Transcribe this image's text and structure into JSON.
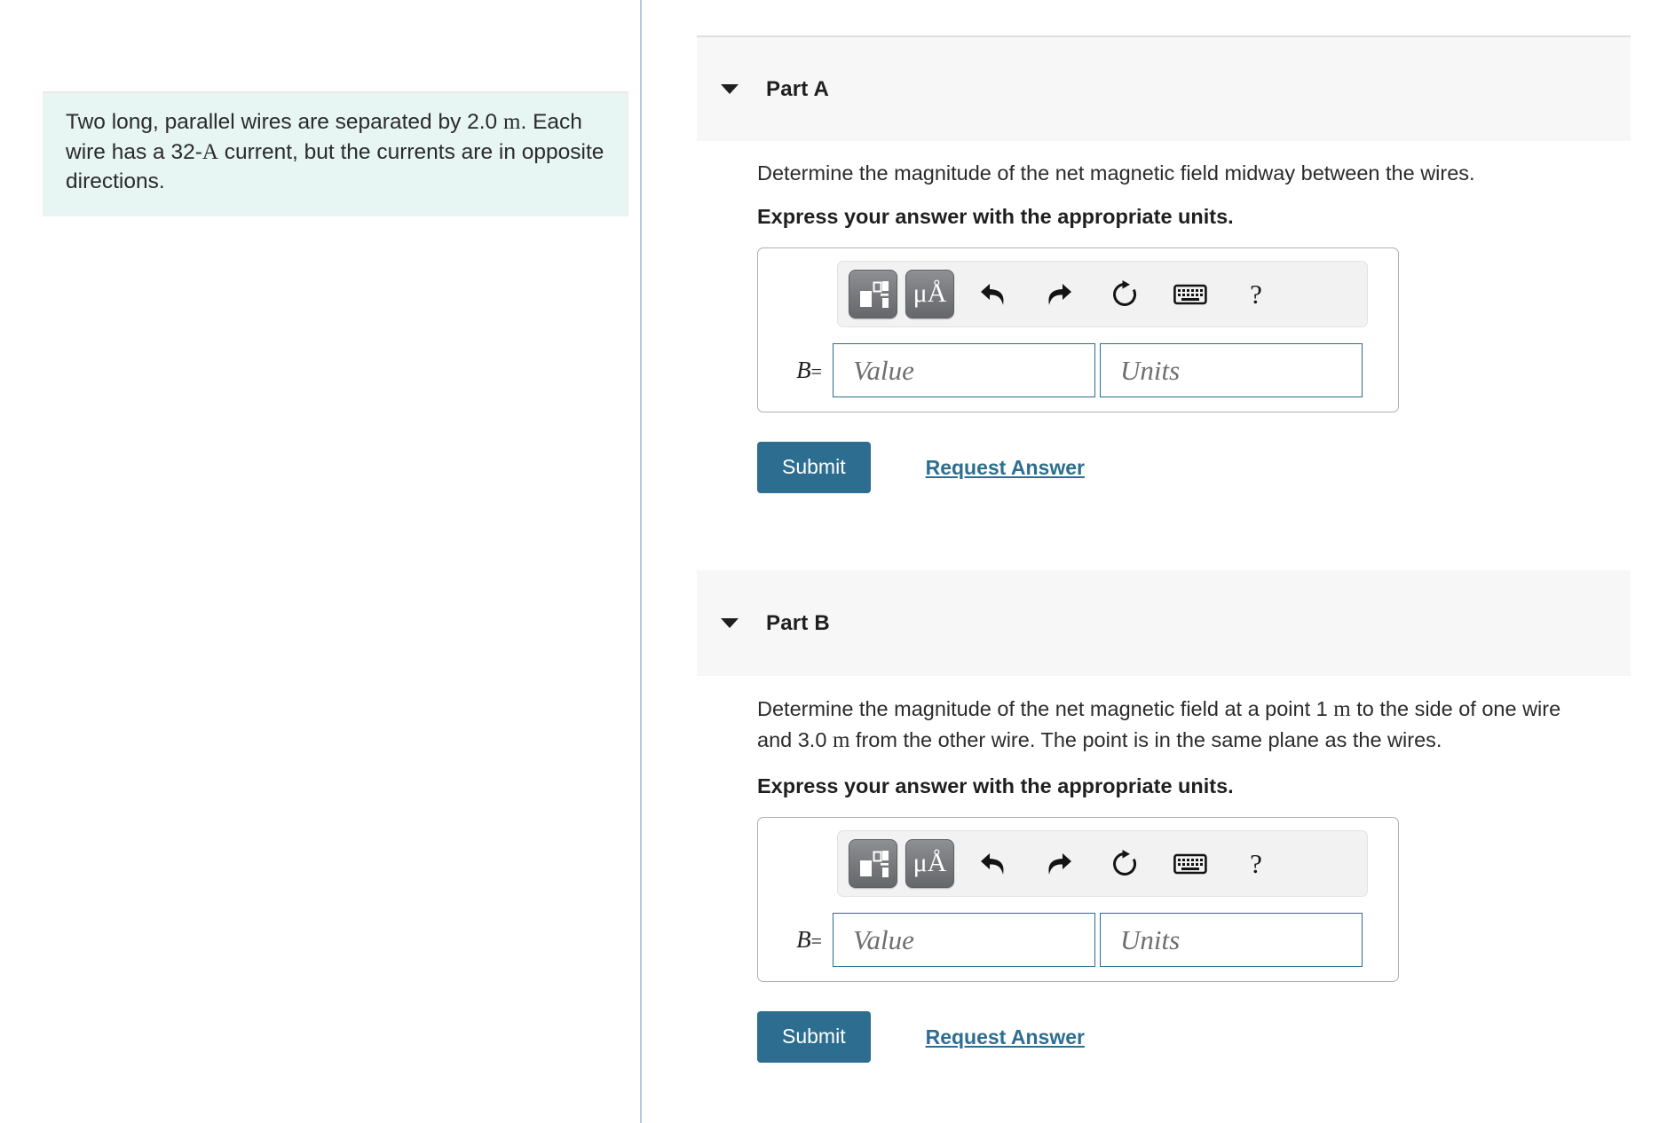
{
  "problem": {
    "text_line1": "Two long, parallel wires are separated by 2.0 ",
    "unit1": "m",
    "text_line1b": ". Each wire has a 32-",
    "unit2": "A",
    "text_line2": " current, but the currents are in opposite directions."
  },
  "parts": [
    {
      "title": "Part A",
      "caret": "chevron-down-icon",
      "question": "Determine the magnitude of the net magnetic field midway between the wires.",
      "instruction": "Express your answer with the appropriate units.",
      "answer": {
        "label": "B",
        "equals": "=",
        "value_placeholder": "Value",
        "units_placeholder": "Units",
        "value_text": "",
        "units_text": ""
      },
      "toolbar": [
        {
          "name": "math-template-icon",
          "title": "Templates"
        },
        {
          "name": "units-mu-angstrom-icon",
          "label": "μÅ",
          "title": "Units"
        },
        {
          "name": "undo-icon",
          "title": "Undo"
        },
        {
          "name": "redo-icon",
          "title": "Redo"
        },
        {
          "name": "reset-icon",
          "title": "Reset"
        },
        {
          "name": "keyboard-icon",
          "title": "Keyboard"
        },
        {
          "name": "help-icon",
          "label": "?",
          "title": "Help"
        }
      ],
      "submit_label": "Submit",
      "request_label": "Request Answer"
    },
    {
      "title": "Part B",
      "caret": "chevron-down-icon",
      "question_pre": "Determine the magnitude of the net magnetic field at a point 1 ",
      "question_unit1": "m",
      "question_mid": " to the side of one wire and 3.0 ",
      "question_unit2": "m",
      "question_post": " from the other wire. The point is in the same plane as the wires.",
      "instruction": "Express your answer with the appropriate units.",
      "answer": {
        "label": "B",
        "equals": "=",
        "value_placeholder": "Value",
        "units_placeholder": "Units",
        "value_text": "",
        "units_text": ""
      },
      "toolbar": [
        {
          "name": "math-template-icon",
          "title": "Templates"
        },
        {
          "name": "units-mu-angstrom-icon",
          "label": "μÅ",
          "title": "Units"
        },
        {
          "name": "undo-icon",
          "title": "Undo"
        },
        {
          "name": "redo-icon",
          "title": "Redo"
        },
        {
          "name": "reset-icon",
          "title": "Reset"
        },
        {
          "name": "keyboard-icon",
          "title": "Keyboard"
        },
        {
          "name": "help-icon",
          "label": "?",
          "title": "Help"
        }
      ],
      "submit_label": "Submit",
      "request_label": "Request Answer"
    }
  ],
  "colors": {
    "accent": "#2d6e90",
    "problem_bg": "#e7f5f3",
    "header_bg": "#f7f7f7",
    "divider": "#b9cbdb",
    "field_border": "#2b6c8f"
  }
}
